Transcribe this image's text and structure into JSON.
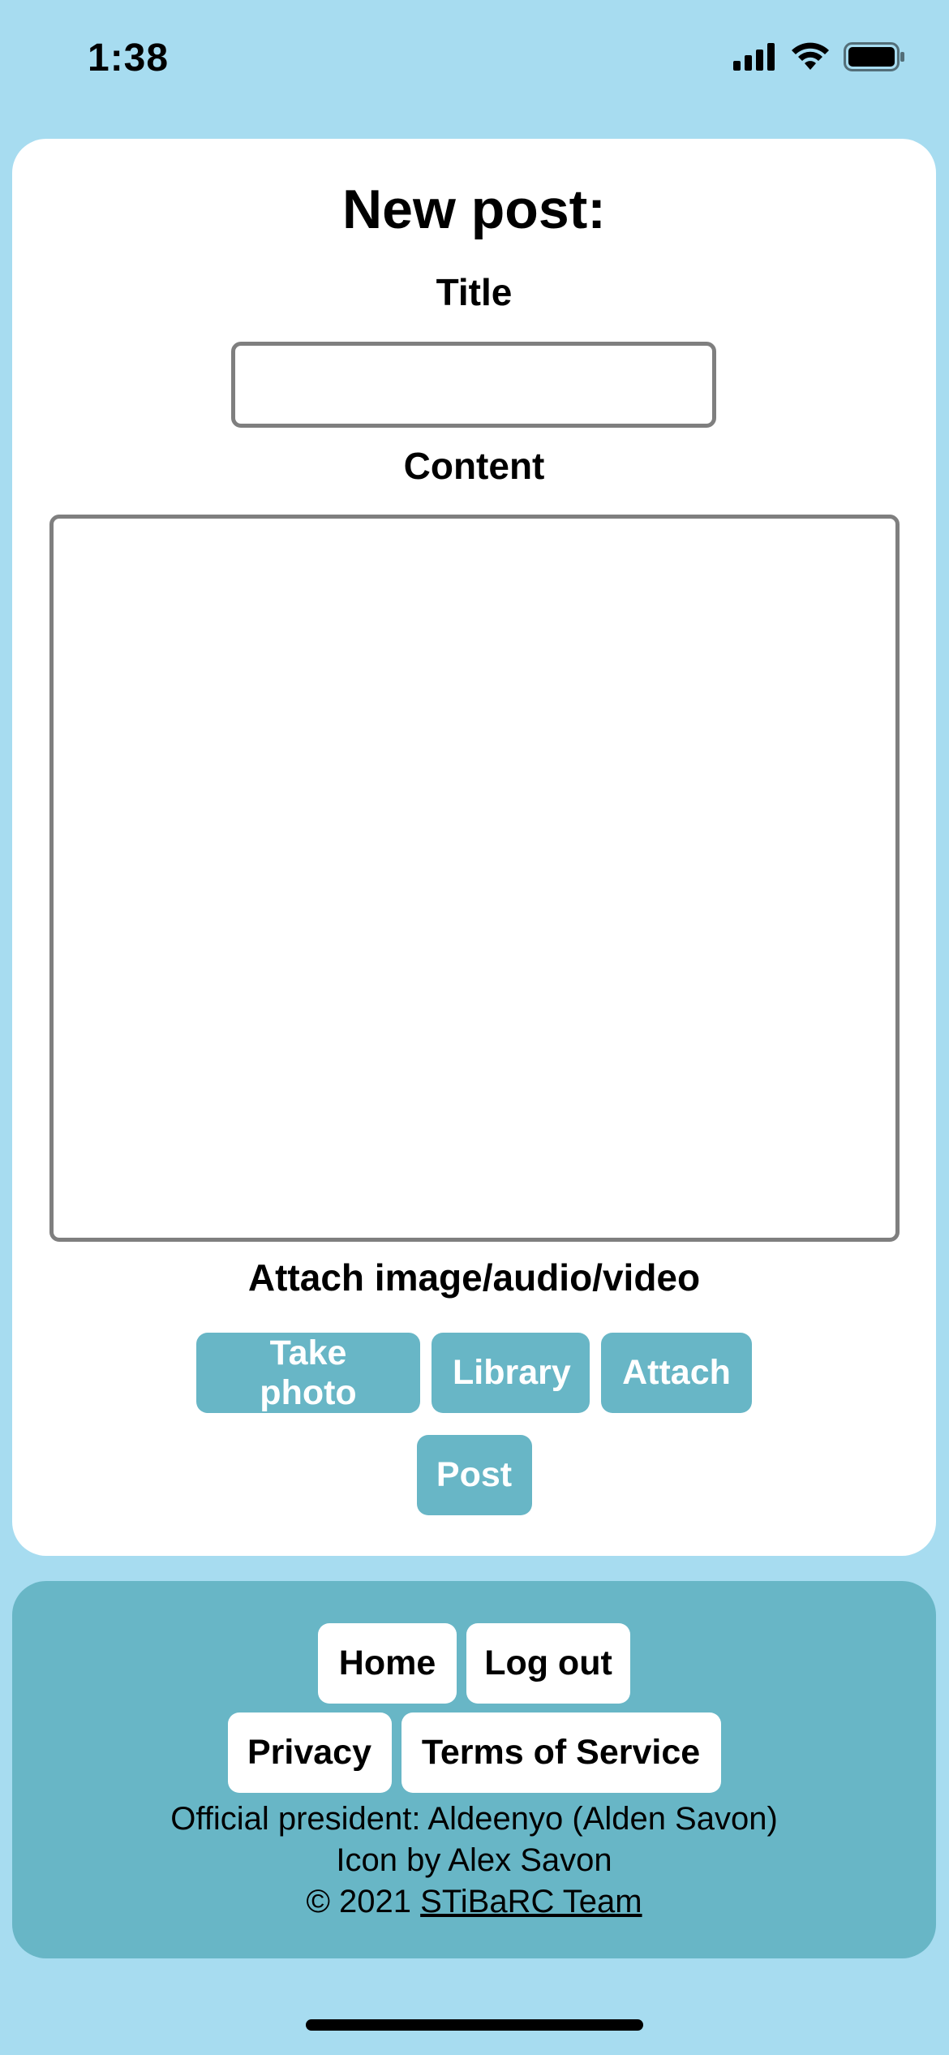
{
  "status_bar": {
    "time": "1:38",
    "icons": [
      "cellular-signal-icon",
      "wifi-icon",
      "battery-icon"
    ]
  },
  "form": {
    "heading": "New post:",
    "title_label": "Title",
    "title_value": "",
    "content_label": "Content",
    "content_value": "",
    "attach_label": "Attach image/audio/video",
    "buttons": {
      "take_photo": "Take photo",
      "library": "Library",
      "attach": "Attach",
      "post": "Post"
    }
  },
  "footer": {
    "nav": {
      "home": "Home",
      "log_out": "Log out",
      "privacy": "Privacy",
      "terms": "Terms of Service"
    },
    "president_line": "Official president: Aldeenyo (Alden Savon)",
    "icon_credit": "Icon by Alex Savon",
    "copyright_prefix": "© 2021",
    "team_link": "STiBaRC Team"
  },
  "colors": {
    "page_background": "#a7dcf0",
    "accent": "#68b6c6",
    "card": "#ffffff",
    "input_border": "#7f7f7f"
  }
}
